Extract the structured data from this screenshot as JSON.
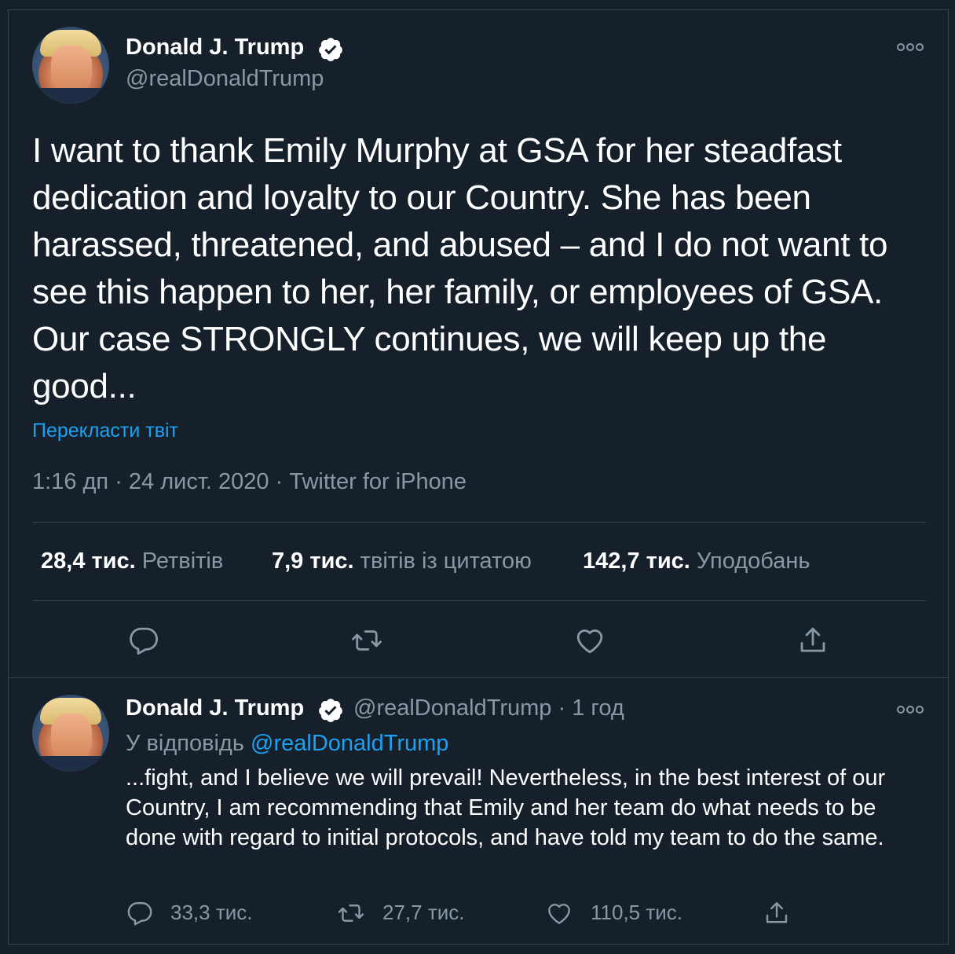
{
  "main_tweet": {
    "author_name": "Donald J. Trump",
    "author_handle": "@realDonaldTrump",
    "text": "I want to thank Emily Murphy at GSA for her steadfast dedication and loyalty to our Country. She has been harassed, threatened, and abused – and I do not want to see this happen to her, her family, or employees of GSA. Our case STRONGLY continues, we will keep up the good...",
    "translate_label": "Перекласти твіт",
    "time": "1:16 дп",
    "date": "24 лист. 2020",
    "source": "Twitter for iPhone",
    "separator": "·",
    "stats": {
      "retweets_value": "28,4 тис.",
      "retweets_label": "Ретвітів",
      "quotes_value": "7,9 тис.",
      "quotes_label": "твітів із цитатою",
      "likes_value": "142,7 тис.",
      "likes_label": "Уподобань"
    }
  },
  "reply_tweet": {
    "author_name": "Donald J. Trump",
    "author_handle": "@realDonaldTrump",
    "dot": "·",
    "time_ago": "1 год",
    "reply_prefix": "У відповідь",
    "reply_mention": "@realDonaldTrump",
    "text": "...fight, and I believe we will prevail! Nevertheless, in the best interest of our Country, I am recommending that Emily and her team do what needs to be done with regard to initial protocols, and have told my team to do the same.",
    "counts": {
      "replies": "33,3 тис.",
      "retweets": "27,7 тис.",
      "likes": "110,5 тис."
    }
  },
  "colors": {
    "background": "#15202b",
    "text": "#ffffff",
    "secondary": "#8899a6",
    "accent": "#1da1f2",
    "divider": "#38444d"
  },
  "icons": {
    "verified": "verified-badge-icon",
    "more": "more-options-icon",
    "reply": "reply-icon",
    "retweet": "retweet-icon",
    "like": "heart-icon",
    "share": "share-icon"
  }
}
